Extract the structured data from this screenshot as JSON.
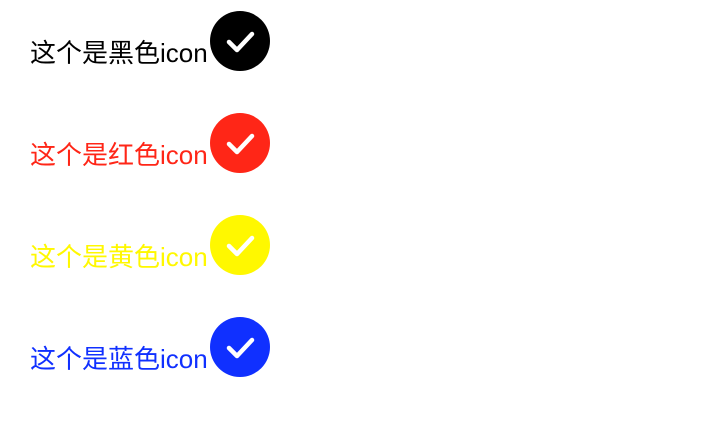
{
  "items": [
    {
      "label": "这个是黑色icon",
      "color": "#000000",
      "icon": "check-circle-icon"
    },
    {
      "label": "这个是红色icon",
      "color": "#ff2617",
      "icon": "check-circle-icon"
    },
    {
      "label": "这个是黄色icon",
      "color": "#fff800",
      "icon": "check-circle-icon"
    },
    {
      "label": "这个是蓝色icon",
      "color": "#1030ff",
      "icon": "check-circle-icon"
    }
  ]
}
